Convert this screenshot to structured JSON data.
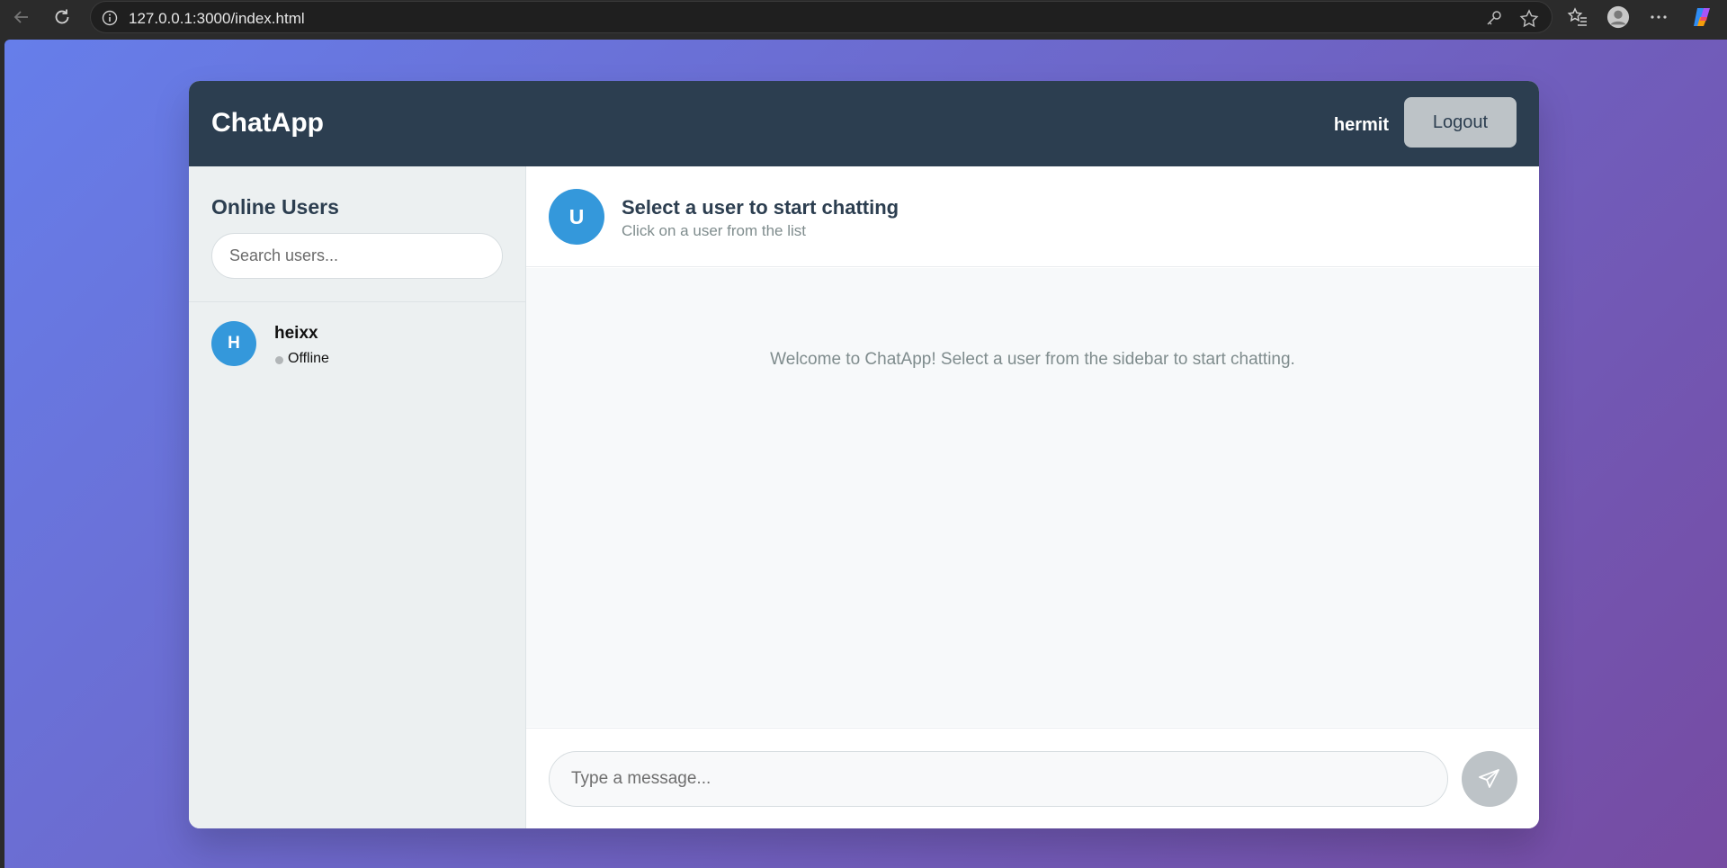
{
  "browser": {
    "url": "127.0.0.1:3000/index.html",
    "icons": [
      "back-icon",
      "reload-icon",
      "info-icon",
      "key-icon",
      "star-icon",
      "favorites-icon",
      "profile-icon",
      "more-icon",
      "copilot-icon"
    ]
  },
  "header": {
    "app_name": "ChatApp",
    "username": "hermit",
    "logout_label": "Logout"
  },
  "sidebar": {
    "title": "Online Users",
    "search_placeholder": "Search users...",
    "users": [
      {
        "initial": "H",
        "name": "heixx",
        "status": "Offline"
      }
    ]
  },
  "chat": {
    "avatar_initial": "U",
    "title": "Select a user to start chatting",
    "subtitle": "Click on a user from the list",
    "welcome": "Welcome to ChatApp! Select a user from the sidebar to start chatting.",
    "input_placeholder": "Type a message...",
    "send_icon": "send-icon"
  },
  "colors": {
    "header_bg": "#2c3e50",
    "sidebar_bg": "#ecf0f1",
    "avatar_bg": "#3498db",
    "button_gray": "#bdc3c7",
    "gradient_start": "#667eea",
    "gradient_end": "#764ba2"
  }
}
